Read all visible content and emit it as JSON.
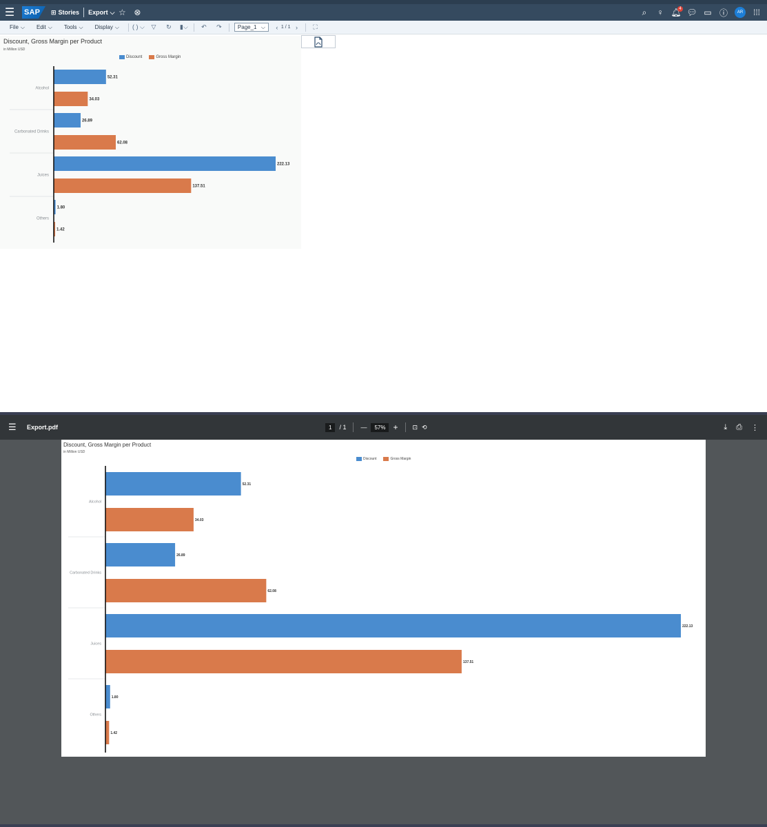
{
  "shell": {
    "logo": "SAP",
    "stories": "Stories",
    "story_name": "Export",
    "notification_count": "4",
    "avatar": "AR"
  },
  "toolbar": {
    "file": "File",
    "edit": "Edit",
    "tools": "Tools",
    "display": "Display",
    "page_select": "Page_1",
    "page_count": "1 / 1"
  },
  "viewer": {
    "title": "Export.pdf",
    "page_current": "1",
    "page_total": "/ 1",
    "zoom": "57%"
  },
  "colors": {
    "discount": "#4a8ccf",
    "gross_margin": "#d97a4b"
  },
  "chart_data": {
    "type": "bar",
    "orientation": "horizontal",
    "title": "Discount, Gross Margin per Product",
    "subtitle": "in Million USD",
    "categories": [
      "Alcohol",
      "Carbonated Drinks",
      "Juices",
      "Others"
    ],
    "series": [
      {
        "name": "Discount",
        "values": [
          52.31,
          26.89,
          222.13,
          1.8
        ],
        "labels": [
          "52.31",
          "26.89",
          "222.13",
          "1.80"
        ]
      },
      {
        "name": "Gross Margin",
        "values": [
          34.03,
          62.08,
          137.51,
          1.42
        ],
        "labels": [
          "34.03",
          "62.08",
          "137.51",
          "1.42"
        ]
      }
    ],
    "legend": "top-center",
    "xlim": [
      0,
      222.13
    ]
  }
}
